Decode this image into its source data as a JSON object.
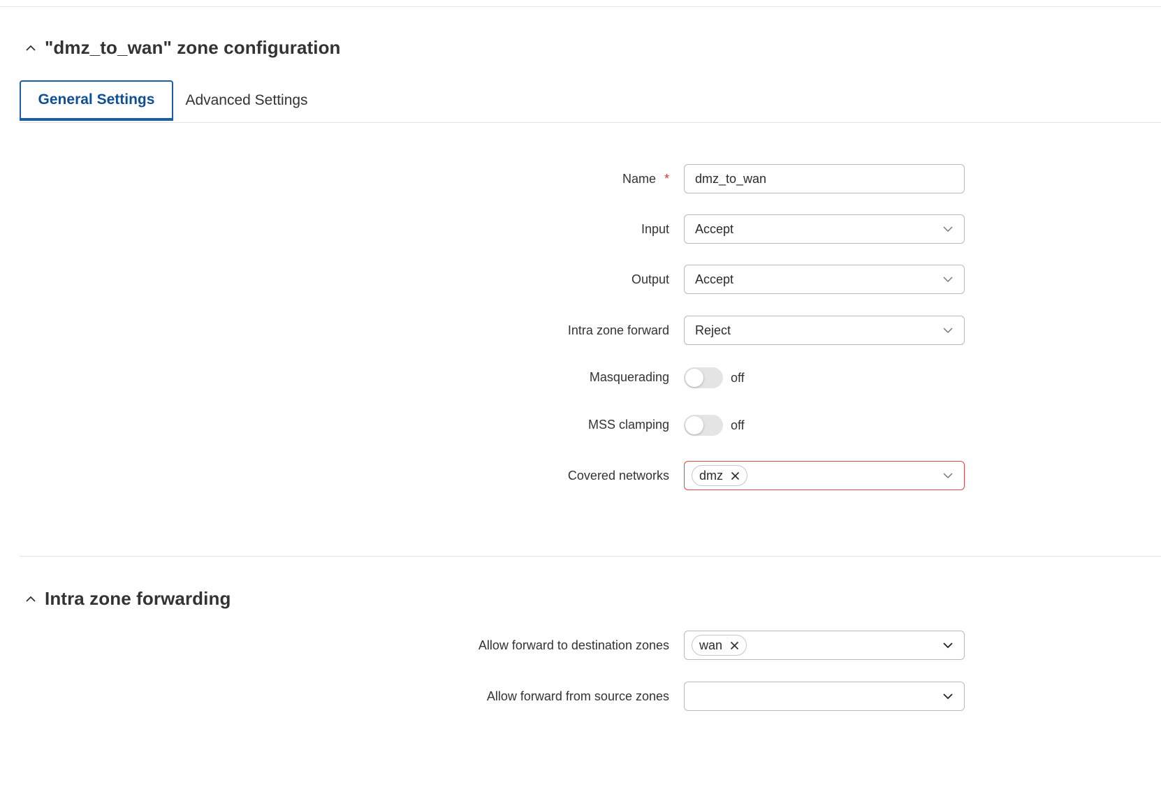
{
  "zone_section": {
    "title": "\"dmz_to_wan\" zone configuration",
    "tabs": [
      {
        "label": "General Settings",
        "active": true
      },
      {
        "label": "Advanced Settings",
        "active": false
      }
    ]
  },
  "general": {
    "name": {
      "label": "Name",
      "value": "dmz_to_wan",
      "required_mark": "*"
    },
    "input": {
      "label": "Input",
      "value": "Accept"
    },
    "output": {
      "label": "Output",
      "value": "Accept"
    },
    "intra_zone_forward": {
      "label": "Intra zone forward",
      "value": "Reject"
    },
    "masquerading": {
      "label": "Masquerading",
      "state": "off"
    },
    "mss_clamping": {
      "label": "MSS clamping",
      "state": "off"
    },
    "covered_networks": {
      "label": "Covered networks",
      "chips": [
        "dmz"
      ],
      "error": true
    }
  },
  "forwarding_section": {
    "title": "Intra zone forwarding",
    "allow_to": {
      "label": "Allow forward to destination zones",
      "chips": [
        "wan"
      ]
    },
    "allow_from": {
      "label": "Allow forward from source zones",
      "chips": []
    }
  },
  "colors": {
    "accent": "#1a5ea8",
    "error_border": "#e0473f",
    "required": "#d13a3a",
    "toggle_off": "#e4e4e4"
  },
  "icons": {
    "collapse": "chevron-up-icon",
    "select": "chevron-down-icon",
    "chip_remove": "close-icon"
  }
}
